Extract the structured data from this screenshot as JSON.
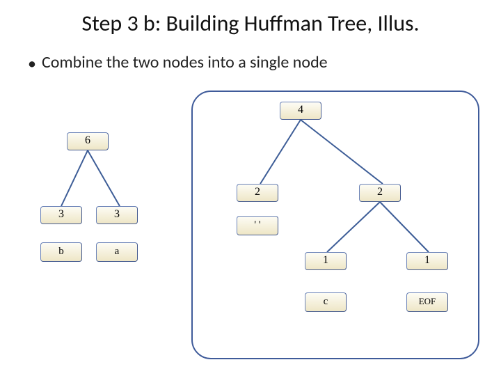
{
  "title": "Step 3 b: Building Huffman Tree, Illus.",
  "bullet": "Combine the two nodes into a single node",
  "colors": {
    "border": "#3f5b9a",
    "nodeFill": "#eee6c6",
    "edge": "#3d5d97"
  },
  "nodes": {
    "left_root_freq": "6",
    "left_l_freq": "3",
    "left_r_freq": "3",
    "left_l_leaf": "b",
    "left_r_leaf": "a",
    "right_root_freq": "4",
    "right_l_freq": "2",
    "right_r_freq": "2",
    "right_l_leaf": "'  '",
    "right_rl_freq": "1",
    "right_rr_freq": "1",
    "right_rl_leaf": "c",
    "right_rr_leaf": "EOF"
  }
}
